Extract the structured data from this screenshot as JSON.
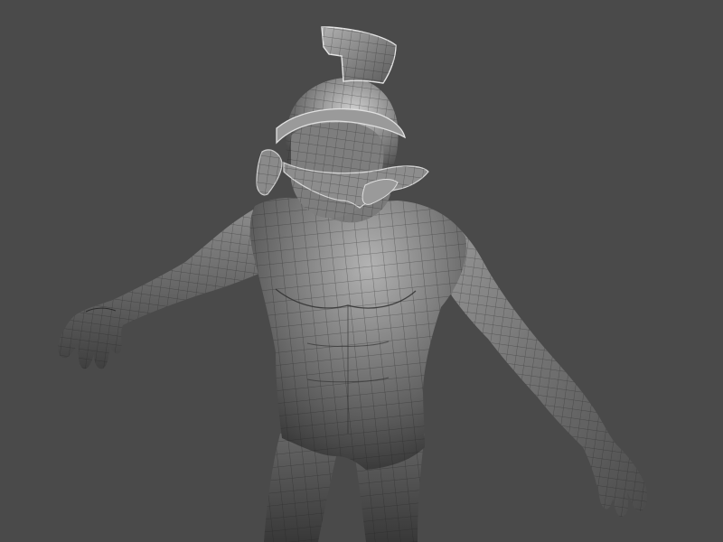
{
  "scene": {
    "subject": "3d-sculpt-wireframe-figure",
    "colors": {
      "background": "#4a4a4a",
      "mesh_base": "#6e6e6e",
      "mesh_light": "#a8a8a8",
      "mesh_shadow": "#303030",
      "wire": "#202020"
    }
  }
}
